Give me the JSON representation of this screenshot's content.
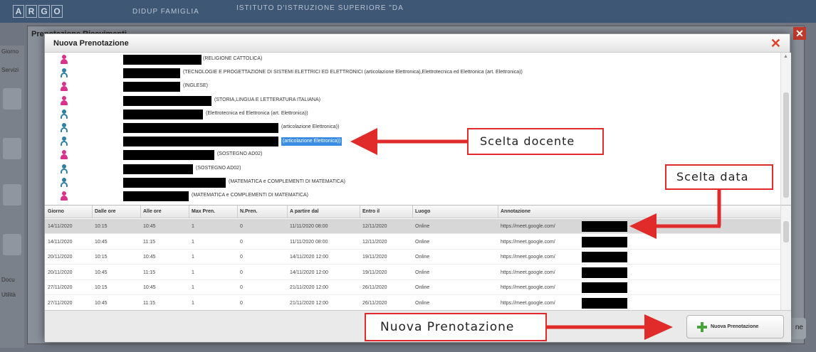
{
  "background_app": {
    "logo_letters": [
      "A",
      "R",
      "G",
      "O"
    ],
    "brand": "DIDUP FAMIGLIA",
    "school": "ISTITUTO D'ISTRUZIONE SUPERIORE \"DA",
    "window_title": "Prenotazione Ricevimenti",
    "sidebar_labels": [
      "Giorno",
      "Servizi",
      "Docu",
      "Utilità"
    ],
    "bottom_button": "ne"
  },
  "modal": {
    "title": "Nuova Prenotazione",
    "close_symbol": "✕"
  },
  "teachers": [
    {
      "gender": "female",
      "subject": "(RELIGIONE CATTOLICA)"
    },
    {
      "gender": "male",
      "subject": "(TECNOLOGIE E PROGETTAZIONE DI SISTEMI ELETTRICI ED ELETTRONICI (articolazione Elettronica),Elettrotecnica ed Elettronica (art. Elettronica))"
    },
    {
      "gender": "female",
      "subject": "(INGLESE)"
    },
    {
      "gender": "female",
      "subject": "(STORIA,LINGUA E LETTERATURA ITALIANA)"
    },
    {
      "gender": "male",
      "subject": "(Elettrotecnica ed Elettronica (art. Elettronica))"
    },
    {
      "gender": "male",
      "subject": "(articolazione Elettronica))"
    },
    {
      "gender": "male",
      "subject": "(articolazione Elettronica))",
      "selected": true
    },
    {
      "gender": "female",
      "subject": "(SOSTEGNO AD02)"
    },
    {
      "gender": "male",
      "subject": "(SOSTEGNO AD02)"
    },
    {
      "gender": "male",
      "subject": "(MATEMATICA e COMPLEMENTI DI MATEMATICA)"
    },
    {
      "gender": "female",
      "subject": "(MATEMATICA e COMPLEMENTI DI MATEMATICA)"
    }
  ],
  "table": {
    "columns": [
      "Giorno",
      "Dalle ore",
      "Alle ore",
      "Max Pren.",
      "N.Pren.",
      "A partire dal",
      "Entro il",
      "Luogo",
      "Annotazione"
    ],
    "rows": [
      {
        "giorno": "14/11/2020",
        "dalle": "10:15",
        "alle": "10:45",
        "max": "1",
        "n": "0",
        "da": "11/11/2020 08:00",
        "entro": "12/11/2020",
        "luogo": "Online",
        "annotazione": "https://meet.google.com/",
        "selected": true
      },
      {
        "giorno": "14/11/2020",
        "dalle": "10:45",
        "alle": "11:15",
        "max": "1",
        "n": "0",
        "da": "11/11/2020 08:00",
        "entro": "12/11/2020",
        "luogo": "Online",
        "annotazione": "https://meet.google.com/"
      },
      {
        "giorno": "20/11/2020",
        "dalle": "10:15",
        "alle": "10:45",
        "max": "1",
        "n": "0",
        "da": "14/11/2020 12:00",
        "entro": "19/11/2020",
        "luogo": "Online",
        "annotazione": "https://meet.google.com/"
      },
      {
        "giorno": "20/11/2020",
        "dalle": "10:45",
        "alle": "11:15",
        "max": "1",
        "n": "0",
        "da": "14/11/2020 12:00",
        "entro": "19/11/2020",
        "luogo": "Online",
        "annotazione": "https://meet.google.com/"
      },
      {
        "giorno": "27/11/2020",
        "dalle": "10:15",
        "alle": "10:45",
        "max": "1",
        "n": "0",
        "da": "21/11/2020 12:00",
        "entro": "26/11/2020",
        "luogo": "Online",
        "annotazione": "https://meet.google.com/"
      },
      {
        "giorno": "27/11/2020",
        "dalle": "10:45",
        "alle": "11:15",
        "max": "1",
        "n": "0",
        "da": "21/11/2020 12:00",
        "entro": "26/11/2020",
        "luogo": "Online",
        "annotazione": "https://meet.google.com/"
      }
    ]
  },
  "footer": {
    "new_booking_label": "Nuova Prenotazione"
  },
  "annotations": {
    "teacher_choice": "Scelta docente",
    "date_choice": "Scelta data",
    "new_booking": "Nuova Prenotazione"
  },
  "colors": {
    "annotation_red": "#e12a2a",
    "selection_blue": "#3b8de3",
    "female_icon": "#d9328c",
    "male_icon": "#2f7fa0",
    "plus_green": "#4aa33a"
  }
}
